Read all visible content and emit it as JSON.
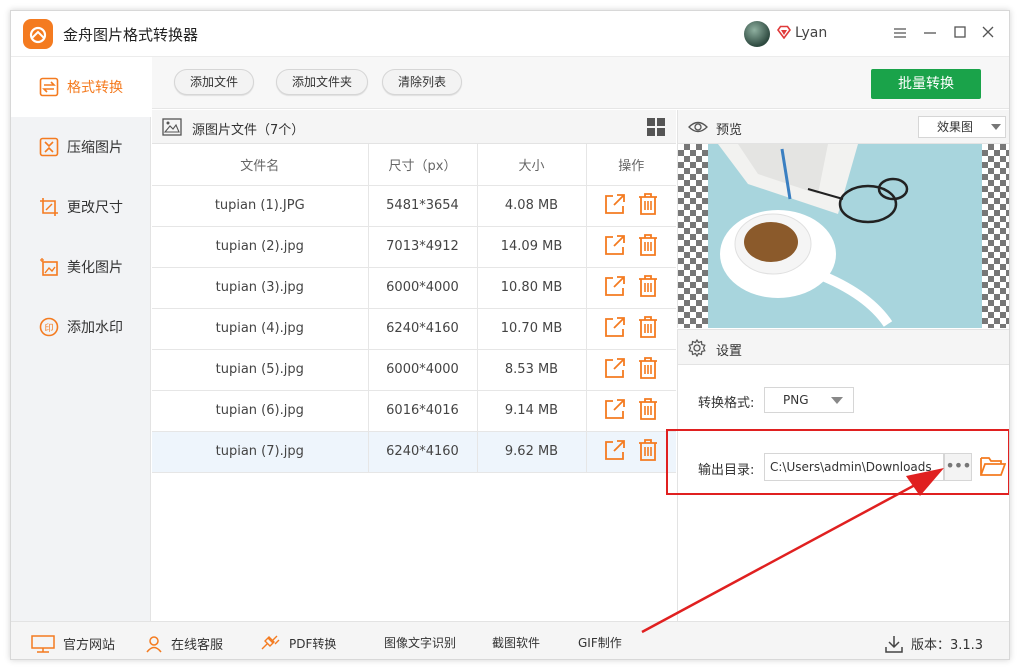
{
  "app": {
    "title": "金舟图片格式转换器",
    "user_name": "Lyan",
    "brand_color": "#f47b20",
    "accent_green": "#1aa34a",
    "highlight_red": "#e02020"
  },
  "window_controls": [
    "menu-icon",
    "minimize-icon",
    "maximize-icon",
    "close-icon"
  ],
  "sidebar": {
    "items": [
      {
        "label": "格式转换",
        "icon": "convert-icon",
        "active": true
      },
      {
        "label": "压缩图片",
        "icon": "compress-icon",
        "active": false
      },
      {
        "label": "更改尺寸",
        "icon": "resize-icon",
        "active": false
      },
      {
        "label": "美化图片",
        "icon": "beautify-icon",
        "active": false
      },
      {
        "label": "添加水印",
        "icon": "watermark-icon",
        "active": false
      }
    ]
  },
  "toolbar": {
    "add_file": "添加文件",
    "add_folder": "添加文件夹",
    "clear_list": "清除列表",
    "batch_convert": "批量转换"
  },
  "file_list": {
    "title": "源图片文件（7个）",
    "columns": [
      "文件名",
      "尺寸（px）",
      "大小",
      "操作"
    ],
    "rows": [
      {
        "name": "tupian (1).JPG",
        "dims": "5481*3654",
        "size": "4.08 MB"
      },
      {
        "name": "tupian (2).jpg",
        "dims": "7013*4912",
        "size": "14.09 MB"
      },
      {
        "name": "tupian (3).jpg",
        "dims": "6000*4000",
        "size": "10.80 MB"
      },
      {
        "name": "tupian (4).jpg",
        "dims": "6240*4160",
        "size": "10.70 MB"
      },
      {
        "name": "tupian (5).jpg",
        "dims": "6000*4000",
        "size": "8.53 MB"
      },
      {
        "name": "tupian (6).jpg",
        "dims": "6016*4016",
        "size": "9.14 MB"
      },
      {
        "name": "tupian (7).jpg",
        "dims": "6240*4160",
        "size": "9.62 MB"
      }
    ],
    "selected_row": 7
  },
  "preview": {
    "title": "预览",
    "mode": "效果图"
  },
  "settings": {
    "title": "设置",
    "format_label": "转换格式:",
    "format_value": "PNG",
    "output_label": "输出目录:",
    "output_path": "C:\\Users\\admin\\Downloads",
    "browse_label": "•••"
  },
  "bottombar": {
    "official_site": "官方网站",
    "online_service": "在线客服",
    "pdf_convert": "PDF转换",
    "ocr": "图像文字识别",
    "screenshot": "截图软件",
    "gif": "GIF制作",
    "version": "版本：3.1.3"
  }
}
